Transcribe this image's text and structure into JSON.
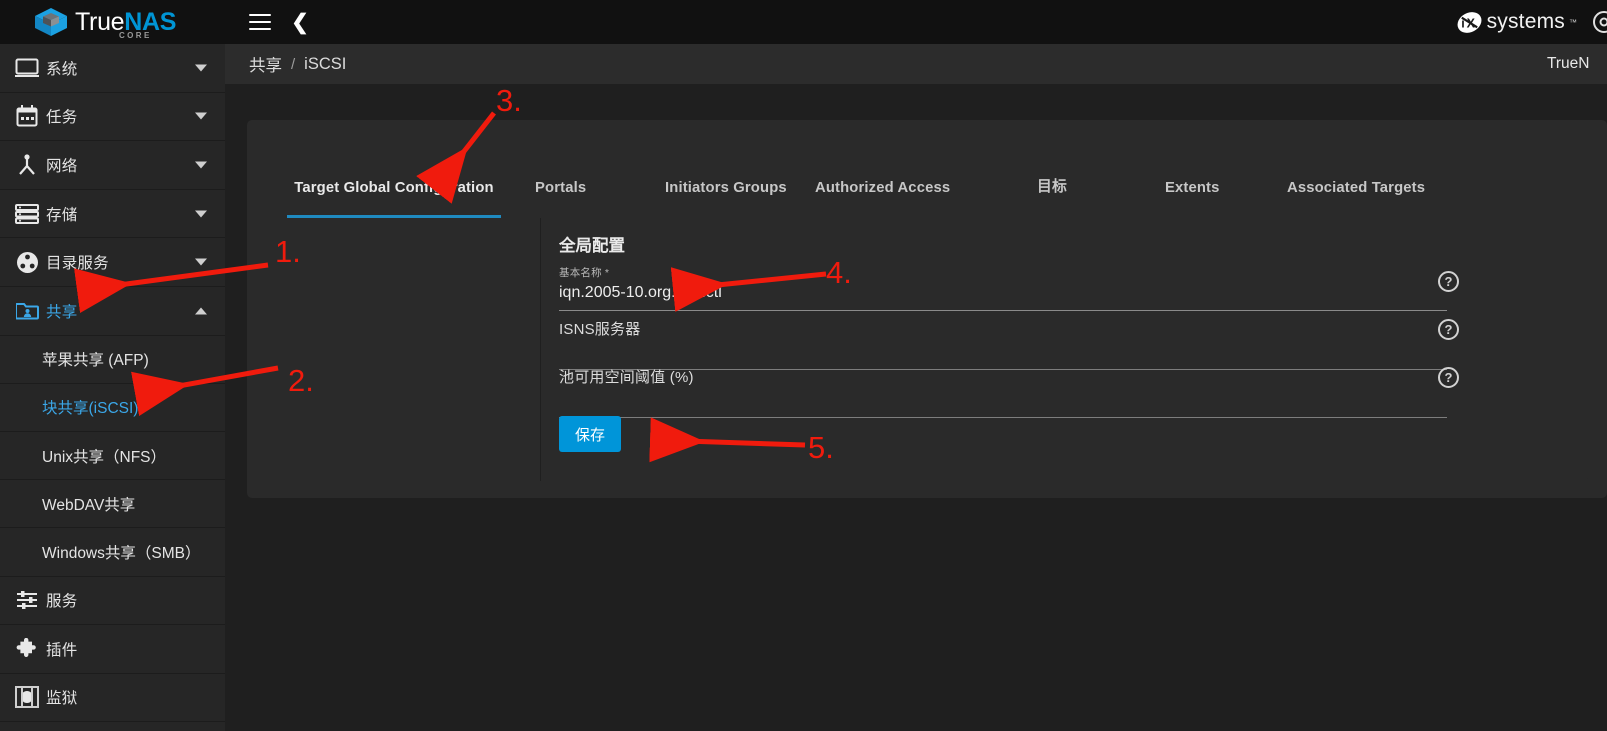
{
  "app": {
    "logo_true": "True",
    "logo_nas": "NAS",
    "logo_core": "CORE",
    "vendor_name": "systems",
    "vendor_mark": "iX",
    "vendor_tm": "™"
  },
  "topbar": {
    "menu_icon": "hamburger-menu-icon",
    "back_icon": "chevron-left-icon"
  },
  "breadcrumb": {
    "parent": "共享",
    "separator": "/",
    "current": "iSCSI",
    "right_text": "TrueN"
  },
  "sidebar": {
    "items": [
      {
        "label": "系统",
        "icon": "monitor-icon",
        "caret": "down",
        "active": false
      },
      {
        "label": "任务",
        "icon": "calendar-icon",
        "caret": "down",
        "active": false
      },
      {
        "label": "网络",
        "icon": "network-icon",
        "caret": "down",
        "active": false
      },
      {
        "label": "存储",
        "icon": "storage-icon",
        "caret": "down",
        "active": false
      },
      {
        "label": "目录服务",
        "icon": "directory-icon",
        "caret": "down",
        "active": false
      },
      {
        "label": "共享",
        "icon": "share-folder-icon",
        "caret": "up",
        "active": true
      }
    ],
    "sub_items": [
      {
        "label": "苹果共享 (AFP)",
        "active": false
      },
      {
        "label": "块共享(iSCSI)",
        "active": true
      },
      {
        "label": "Unix共享（NFS）",
        "active": false
      },
      {
        "label": "WebDAV共享",
        "active": false
      },
      {
        "label": "Windows共享（SMB）",
        "active": false
      }
    ],
    "bottom_items": [
      {
        "label": "服务",
        "icon": "sliders-icon"
      },
      {
        "label": "插件",
        "icon": "puzzle-icon"
      },
      {
        "label": "监狱",
        "icon": "jail-icon"
      }
    ]
  },
  "tabs": [
    {
      "label": "Target Global Configuration",
      "active": true
    },
    {
      "label": "Portals",
      "active": false
    },
    {
      "label": "Initiators Groups",
      "active": false
    },
    {
      "label": "Authorized Access",
      "active": false
    },
    {
      "label": "目标",
      "active": false
    },
    {
      "label": "Extents",
      "active": false
    },
    {
      "label": "Associated Targets",
      "active": false
    }
  ],
  "form": {
    "title": "全局配置",
    "fields": [
      {
        "label": "基本名称 *",
        "value": "iqn.2005-10.org.pve.ctl",
        "help": "?"
      },
      {
        "label": "ISNS服务器",
        "value": "",
        "help": "?"
      },
      {
        "label": "池可用空间阈值 (%)",
        "value": "",
        "help": "?"
      }
    ],
    "save_label": "保存"
  },
  "annotations": [
    {
      "number": "1."
    },
    {
      "number": "2."
    },
    {
      "number": "3."
    },
    {
      "number": "4."
    },
    {
      "number": "5."
    }
  ],
  "colors": {
    "accent_blue": "#0095d9",
    "tab_underline": "#1f8ac0",
    "annotation_red": "#f01b0d",
    "active_link": "#3ba7e8"
  }
}
